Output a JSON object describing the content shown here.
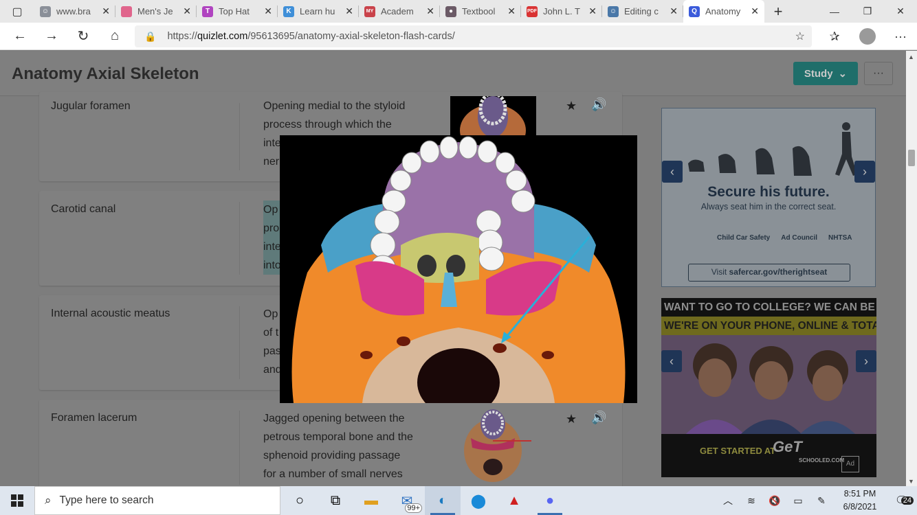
{
  "browser": {
    "tabs": [
      {
        "title": "www.bra",
        "color": "#8a8f98",
        "glyph": "☺"
      },
      {
        "title": "Men's Je",
        "color": "#e0658c",
        "glyph": ""
      },
      {
        "title": "Top Hat",
        "color": "#b044c0",
        "glyph": "T"
      },
      {
        "title": "Learn hu",
        "color": "#3f8fd8",
        "glyph": "K"
      },
      {
        "title": "Academ",
        "color": "#c9424a",
        "glyph": "MY"
      },
      {
        "title": "Textbool",
        "color": "#6b5a66",
        "glyph": "●"
      },
      {
        "title": "John L. T",
        "color": "#d93333",
        "glyph": "PDF"
      },
      {
        "title": "Editing c",
        "color": "#4a78a8",
        "glyph": "☺"
      },
      {
        "title": "Anatomy",
        "color": "#3b5bdb",
        "glyph": "Q"
      }
    ],
    "active_tab_index": 8,
    "url_prefix": "https://",
    "url_host": "quizlet.com",
    "url_path": "/95613695/anatomy-axial-skeleton-flash-cards/"
  },
  "page": {
    "title": "Anatomy Axial Skeleton",
    "study_label": "Study",
    "more_label": "···",
    "cards": [
      {
        "term": "Jugular foramen",
        "definition": "Opening medial to the styloid process through which the inte ner"
      },
      {
        "term": "Carotid canal",
        "definition": "Op pro inte into"
      },
      {
        "term": "Internal acoustic meatus",
        "definition": "Op of t pas and"
      },
      {
        "term": "Foramen lacerum",
        "definition": "Jagged opening between the petrous temporal bone and the sphenoid providing passage for a number of small nerves"
      }
    ]
  },
  "ads": {
    "ad1": {
      "headline": "Secure his future.",
      "sub": "Always seat him in the correct seat.",
      "logo1": "Child Car Safety",
      "logo2": "Ad Council",
      "logo3": "NHTSA",
      "visit_prefix": "Visit ",
      "visit_link": "safercar.gov/therightseat"
    },
    "ad2": {
      "line1": "WANT TO GO TO COLLEGE? WE CAN BE YOUR GUIDE.",
      "line2": "WE'RE ON YOUR PHONE, ONLINE & TOTALLY FREE.",
      "cta": "GET STARTED AT",
      "brand": "GeT",
      "brand2": "SCHOOLED.COM",
      "adcouncil": "Ad"
    }
  },
  "taskbar": {
    "search_placeholder": "Type here to search",
    "mail_badge": "99+",
    "time": "8:51 PM",
    "date": "6/8/2021",
    "notifications": "24"
  }
}
